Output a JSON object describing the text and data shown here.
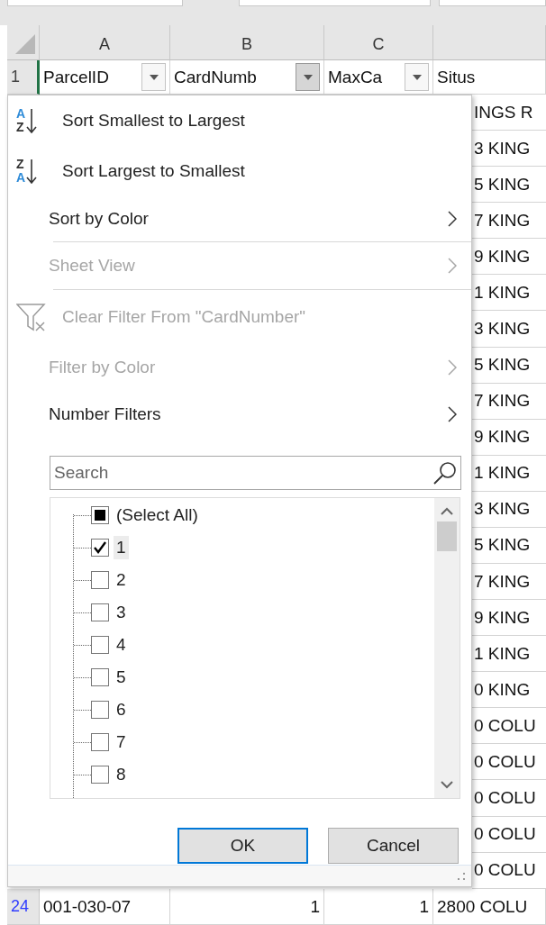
{
  "column_headers": [
    {
      "label": "A"
    },
    {
      "label": "B"
    },
    {
      "label": "C"
    }
  ],
  "header_row": {
    "number": "1",
    "active": true,
    "cells": [
      {
        "kind": "filter",
        "text": "ParcelID",
        "open": false
      },
      {
        "kind": "filter",
        "text": "CardNumb",
        "open": true
      },
      {
        "kind": "filter",
        "text": "MaxCa",
        "open": false
      },
      {
        "kind": "plain",
        "text": "Situs"
      }
    ]
  },
  "visible_cells": [
    "INGS R",
    "3 KING",
    "5 KING",
    "7 KING",
    "9 KING",
    "1 KING",
    "3 KING",
    "5 KING",
    "7 KING",
    "9 KING",
    "1 KING",
    "3 KING",
    "5 KING",
    "7 KING",
    "9 KING",
    "1 KING",
    "0 KING",
    "0 COLU",
    "0 COLU",
    "0 COLU",
    "0 COLU",
    "0 COLU"
  ],
  "menu": {
    "items": [
      {
        "kind": "sort-asc",
        "label": "Sort Smallest to Largest",
        "icon_top": "A",
        "icon_bottom": "Z",
        "disabled": false
      },
      {
        "kind": "sort-desc",
        "label": "Sort Largest to Smallest",
        "icon_top": "Z",
        "icon_bottom": "A",
        "disabled": false
      },
      {
        "kind": "submenu",
        "label": "Sort by Color",
        "disabled": false
      },
      {
        "kind": "separator"
      },
      {
        "kind": "submenu",
        "label": "Sheet View",
        "disabled": true
      },
      {
        "kind": "separator"
      },
      {
        "kind": "clear-filter",
        "label": "Clear Filter From \"CardNumber\"",
        "disabled": true
      },
      {
        "kind": "submenu",
        "label": "Filter by Color",
        "disabled": true
      },
      {
        "kind": "submenu",
        "label": "Number Filters",
        "disabled": false
      }
    ],
    "search": {
      "placeholder": "Search"
    },
    "values": [
      {
        "label": "(Select All)",
        "checked": false,
        "partial": true,
        "selected": false
      },
      {
        "label": "1",
        "checked": true,
        "selected": true
      },
      {
        "label": "2",
        "checked": false,
        "selected": false
      },
      {
        "label": "3",
        "checked": false,
        "selected": false
      },
      {
        "label": "4",
        "checked": false,
        "selected": false
      },
      {
        "label": "5",
        "checked": false,
        "selected": false
      },
      {
        "label": "6",
        "checked": false,
        "selected": false
      },
      {
        "label": "7",
        "checked": false,
        "selected": false
      },
      {
        "label": "8",
        "checked": false,
        "selected": false
      }
    ],
    "buttons": [
      {
        "label": "OK",
        "focused": true
      },
      {
        "label": "Cancel",
        "focused": false
      }
    ]
  },
  "last_row": {
    "number": "24",
    "filtered": true,
    "cells": [
      {
        "text": "001-030-07",
        "numeric": false
      },
      {
        "text": "1",
        "numeric": true
      },
      {
        "text": "1",
        "numeric": true
      },
      {
        "text": "2800 COLU",
        "numeric": false
      }
    ]
  }
}
